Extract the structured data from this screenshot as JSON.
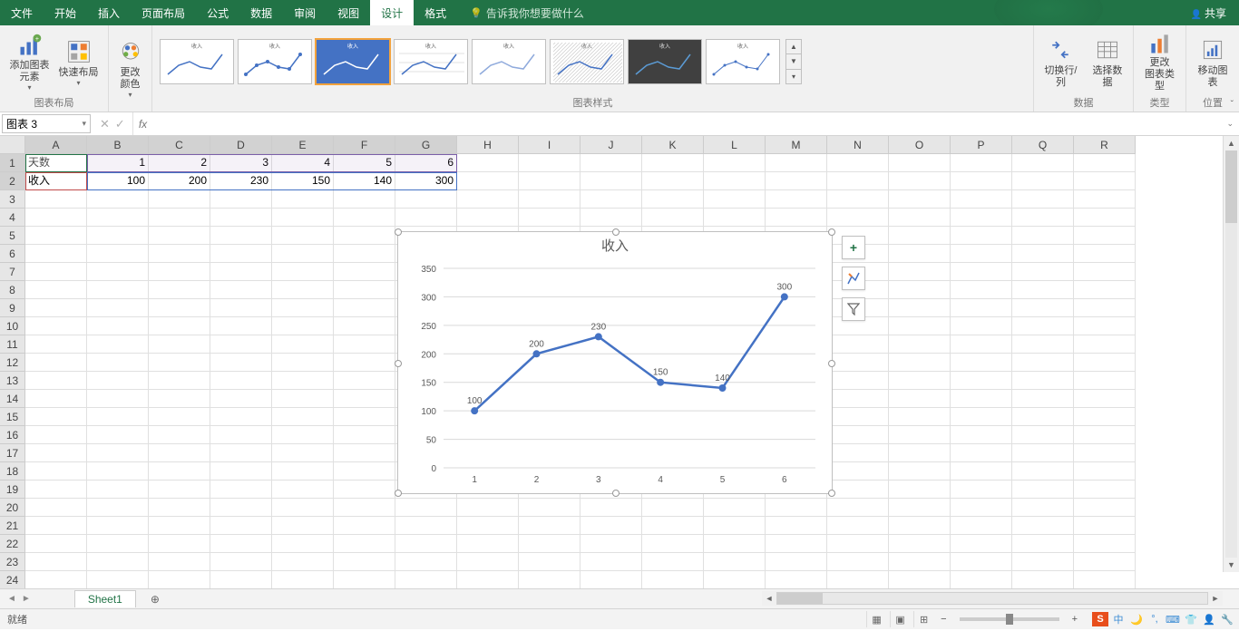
{
  "menu": {
    "file": "文件",
    "home": "开始",
    "insert": "插入",
    "layout": "页面布局",
    "formulas": "公式",
    "data": "数据",
    "review": "审阅",
    "view": "视图",
    "design": "设计",
    "format": "格式",
    "tellme": "告诉我你想要做什么",
    "share": "共享"
  },
  "ribbon": {
    "layout_group": "图表布局",
    "add_element": "添加图表\n元素",
    "quick_layout": "快速布局",
    "change_colors": "更改\n颜色",
    "styles_group": "图表样式",
    "switch_rowcol": "切换行/列",
    "select_data": "选择数据",
    "data_group": "数据",
    "change_type": "更改\n图表类型",
    "type_group": "类型",
    "move_chart": "移动图表",
    "location_group": "位置"
  },
  "namebox": "图表 3",
  "columns": [
    "A",
    "B",
    "C",
    "D",
    "E",
    "F",
    "G",
    "H",
    "I",
    "J",
    "K",
    "L",
    "M",
    "N",
    "O",
    "P",
    "Q",
    "R"
  ],
  "rows": 24,
  "table": {
    "r1": [
      "天数",
      "1",
      "2",
      "3",
      "4",
      "5",
      "6"
    ],
    "r2": [
      "收入",
      "100",
      "200",
      "230",
      "150",
      "140",
      "300"
    ]
  },
  "chart_data": {
    "type": "line",
    "title": "收入",
    "categories": [
      "1",
      "2",
      "3",
      "4",
      "5",
      "6"
    ],
    "series": [
      {
        "name": "收入",
        "values": [
          100,
          200,
          230,
          150,
          140,
          300
        ]
      }
    ],
    "ylim": [
      0,
      350
    ],
    "ytick": 50,
    "data_labels": true
  },
  "sheet": {
    "tab": "Sheet1"
  },
  "status": {
    "ready": "就绪"
  },
  "side_btns": {
    "plus": "+",
    "brush": "brush",
    "filter": "filter"
  },
  "style_title": "收入"
}
